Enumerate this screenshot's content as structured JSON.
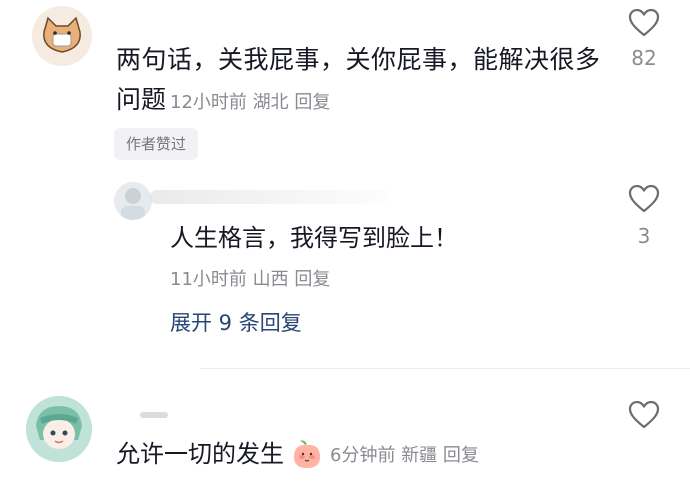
{
  "comments": [
    {
      "text_line1": "两句话，关我屁事，关你屁事，能解决很多",
      "text_line2": "问题",
      "time": "12小时前",
      "location": "湖北",
      "reply": "回复",
      "badge": "作者赞过",
      "likes": "82"
    },
    {
      "text": "人生格言，我得写到脸上！",
      "time": "11小时前",
      "location": "山西",
      "reply": "回复",
      "likes": "3",
      "expand": "展开 9 条回复"
    },
    {
      "text": "允许一切的发生",
      "time": "6分钟前",
      "location": "新疆",
      "reply": "回复"
    }
  ],
  "icons": {
    "like": "heart-outline-icon",
    "emoji": "peach-emoji-icon"
  },
  "colors": {
    "meta": "#8a8b91",
    "expand_link": "#294573",
    "badge_bg": "#f2f2f4"
  }
}
